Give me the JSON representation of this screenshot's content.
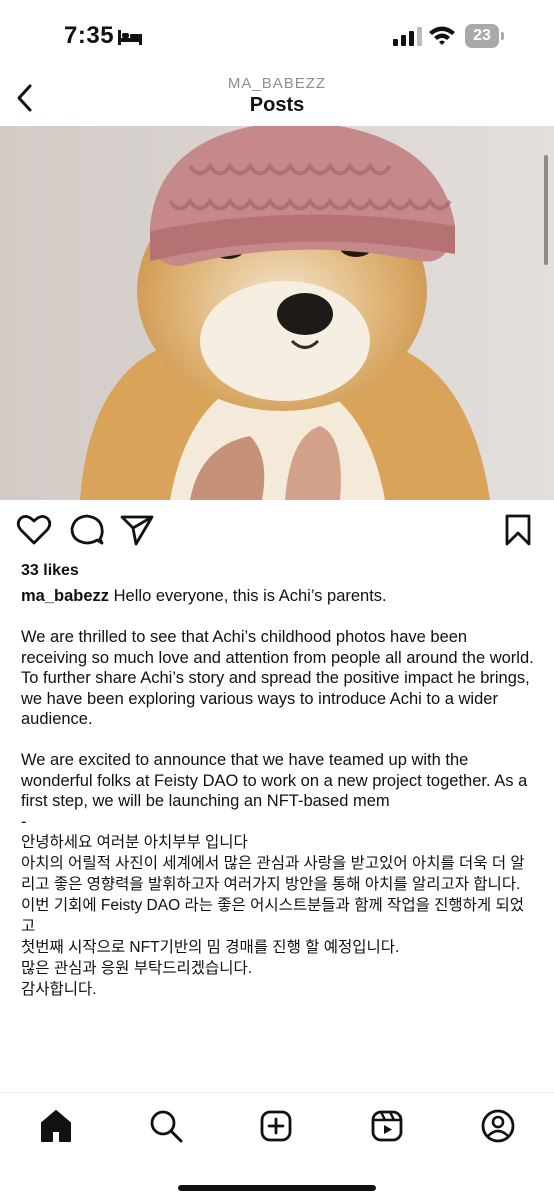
{
  "status_bar": {
    "time": "7:35",
    "battery": "23"
  },
  "header": {
    "username": "MA_BABEZZ",
    "title": "Posts"
  },
  "post": {
    "likes": "33 likes",
    "username": "ma_babezz",
    "caption_first": "Hello everyone, this is Achi’s parents.",
    "para2": "We are thrilled to see that Achi’s childhood photos have been receiving so much love and attention from people all around the world. To further share Achi’s story and spread the positive impact he brings, we have been exploring various ways to introduce Achi to a wider audience.",
    "para3": "We are excited to announce that we have teamed up with the wonderful folks at Feisty DAO to work on a new project together. As a first step, we will be launching an NFT-based mem",
    "dash": "-",
    "ko1": "안녕하세요 여러분 아치부부 입니다",
    "ko2": " 아치의 어릴적 사진이 세계에서 많은 관심과 사랑을 받고있어 아치를 더욱 더 알리고 좋은 영향력을 발휘하고자 여러가지 방안을 통해 아치를 알리고자 합니다.",
    "ko3": "이번 기회에 Feisty DAO 라는 좋은 어시스트분들과 함께 작업을 진행하게 되었고",
    "ko4": "첫번째 시작으로 NFT기반의 밈 경매를 진행 할 예정입니다.",
    "ko5": "많은 관심과 응원 부탁드리겠습니다.",
    "ko6": "감사합니다."
  },
  "icons": {
    "status": [
      "bed-icon",
      "signal-icon",
      "wifi-icon",
      "battery-icon"
    ],
    "actions": [
      "heart-icon",
      "comment-icon",
      "share-icon",
      "bookmark-icon"
    ],
    "nav": [
      "home-icon",
      "search-icon",
      "create-icon",
      "reels-icon",
      "profile-icon"
    ]
  },
  "colors": {
    "text": "#111111",
    "secondary": "#8e8e8e",
    "background": "#ffffff"
  }
}
